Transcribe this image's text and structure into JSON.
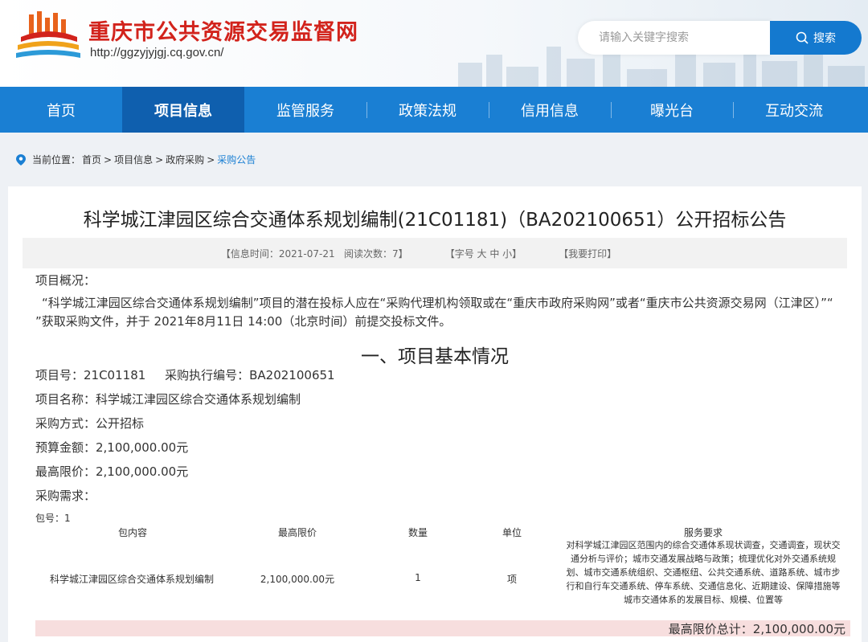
{
  "site": {
    "title": "重庆市公共资源交易监督网",
    "url": "http://ggzyjyjgj.cq.gov.cn/",
    "search_placeholder": "请输入关键字搜索",
    "search_label": "搜索",
    "accent_color": "#1a7fd3",
    "title_color": "#d2231c"
  },
  "nav": {
    "items": [
      {
        "label": "首页"
      },
      {
        "label": "项目信息"
      },
      {
        "label": "监管服务"
      },
      {
        "label": "政策法规"
      },
      {
        "label": "信用信息"
      },
      {
        "label": "曝光台"
      },
      {
        "label": "互动交流"
      }
    ],
    "active": "项目信息"
  },
  "breadcrumb": {
    "prefix": "当前位置：",
    "items": [
      "首页",
      "项目信息",
      "政府采购",
      "采购公告"
    ],
    "sep": ">"
  },
  "article": {
    "title": "科学城江津园区综合交通体系规划编制(21C01181)（BA202100651）公开招标公告",
    "meta": {
      "info_time": "【信息时间：2021-07-21",
      "views": "阅读次数：7】",
      "font_size": "【字号 大 中 小】",
      "print": "【我要打印】"
    },
    "overview_label": "项目概况：",
    "overview_text": "“科学城江津园区综合交通体系规划编制”项目的潜在投标人应在“采购代理机构领取或在“重庆市政府采购网”或者“重庆市公共资源交易网（江津区）”“ ”获取采购文件，并于 2021年8月11日 14:00（北京时间）前提交投标文件。",
    "section1": "一、项目基本情况",
    "project_no": "项目号：21C01181",
    "exec_no": "采购执行编号：BA202100651",
    "project_name": "项目名称：科学城江津园区综合交通体系规划编制",
    "method": "采购方式：公开招标",
    "budget": "预算金额：2,100,000.00元",
    "max_price": "最高限价：2,100,000.00元",
    "demand": "采购需求："
  },
  "table": {
    "package": "包号：1",
    "headers": [
      "包内容",
      "最高限价",
      "数量",
      "单位",
      "服务要求"
    ],
    "row": {
      "content": "科学城江津园区综合交通体系规划编制",
      "max_price": "2,100,000.00元",
      "quantity": "1",
      "unit": "项",
      "requirement": "对科学城江津园区范围内的综合交通体系现状调查，交通调查，现状交通分析与评价；城市交通发展战略与政策；梳理优化对外交通系统规划、城市交通系统组织、交通枢纽、公共交通系统、道路系统、城市步行和自行车交通系统、停车系统、交通信息化、近期建设、保障措施等城市交通体系的发展目标、规模、位置等"
    },
    "total": "最高限价总计：2,100,000.00元"
  }
}
